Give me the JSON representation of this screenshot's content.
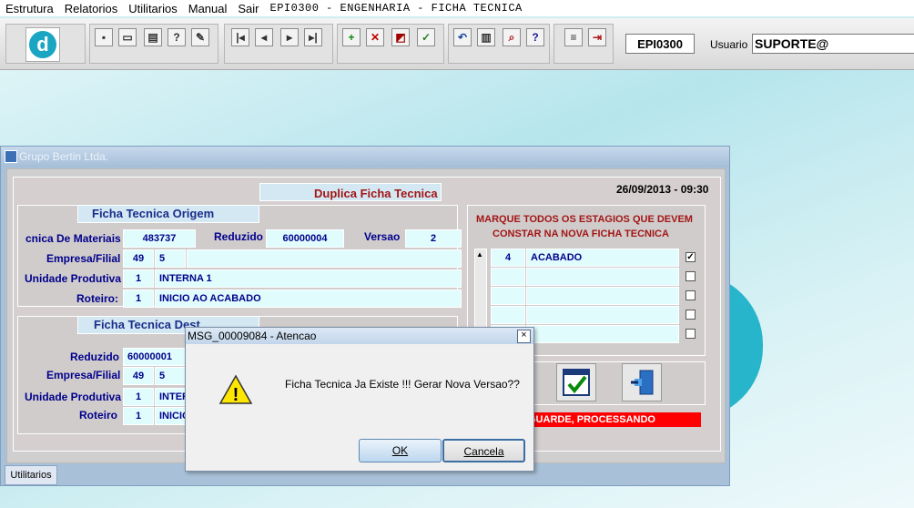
{
  "menu": {
    "items": [
      "Estrutura",
      "Relatorios",
      "Utilitarios",
      "Manual",
      "Sair"
    ],
    "title": "EPI0300 - ENGENHARIA - FICHA TECNICA"
  },
  "toolbar": {
    "logo_letter": "d",
    "form_code": "EPI0300",
    "user_label": "Usuario",
    "user_value": "SUPORTE@"
  },
  "window": {
    "title": "Grupo Bertin Ltda.",
    "heading": "Duplica Ficha Tecnica",
    "datetime": "26/09/2013 - 09:30",
    "origem": {
      "title": "Ficha Tecnica Origem",
      "estrutura_label": "cnica De Materiais",
      "estrutura_value": "483737",
      "reduzido_label": "Reduzido",
      "reduzido_value": "60000004",
      "versao_label": "Versao",
      "versao_value": "2",
      "empresa_label": "Empresa/Filial",
      "empresa_value": "49",
      "filial_value": "5",
      "unidade_label": "Unidade Produtiva",
      "unidade_code": "1",
      "unidade_name": "INTERNA 1",
      "roteiro_label": "Roteiro:",
      "roteiro_code": "1",
      "roteiro_name": "INICIO AO ACABADO"
    },
    "destino": {
      "title": "Ficha Tecnica Dest",
      "reduzido_label": "Reduzido",
      "reduzido_value": "60000001",
      "empresa_label": "Empresa/Filial",
      "empresa_value": "49",
      "filial_value": "5",
      "unidade_label": "Unidade Produtiva",
      "unidade_code": "1",
      "unidade_name": "INTER",
      "roteiro_label": "Roteiro",
      "roteiro_code": "1",
      "roteiro_name": "INICIO"
    },
    "estagios": {
      "instruction_line1": "MARQUE TODOS OS ESTAGIOS QUE DEVEM",
      "instruction_line2": "CONSTAR NA NOVA FICHA TECNICA",
      "rows": [
        {
          "code": "4",
          "name": "ACABADO",
          "checked": true,
          "mark": "✓"
        },
        {
          "code": "",
          "name": "",
          "checked": false,
          "mark": ""
        },
        {
          "code": "",
          "name": "",
          "checked": false,
          "mark": ""
        },
        {
          "code": "",
          "name": "",
          "checked": false,
          "mark": ""
        },
        {
          "code": "",
          "name": "",
          "checked": false,
          "mark": ""
        }
      ]
    },
    "status": "GUARDE, PROCESSANDO",
    "tab_label": "Utilitarios"
  },
  "dialog": {
    "title": "MSG_00009084 - Atencao",
    "message": "Ficha Tecnica Ja Existe !!! Gerar Nova Versao??",
    "ok_label": "OK",
    "cancel_label": "Cancela",
    "close_glyph": "×",
    "warning_glyph": "!"
  },
  "colors": {
    "accent": "#1aa5c2",
    "heading_red": "#a31515",
    "status_red": "#ff0000",
    "label_blue": "#00008b"
  }
}
